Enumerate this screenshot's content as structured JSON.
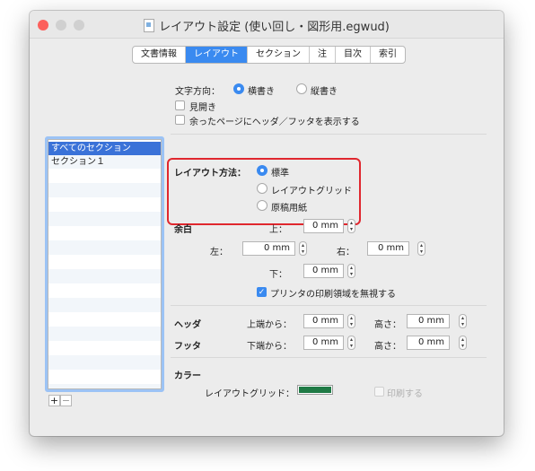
{
  "window": {
    "title": "レイアウト設定 (使い回し・図形用.egwud)",
    "traffic_lights": {
      "close": "#fc605c",
      "minimize": "#d0d0d0",
      "zoom": "#d0d0d0"
    }
  },
  "tabs": [
    {
      "label": "文書情報",
      "active": false
    },
    {
      "label": "レイアウト",
      "active": true
    },
    {
      "label": "セクション",
      "active": false
    },
    {
      "label": "注",
      "active": false
    },
    {
      "label": "目次",
      "active": false
    },
    {
      "label": "索引",
      "active": false
    }
  ],
  "text_direction": {
    "label": "文字方向：",
    "options": [
      {
        "label": "横書き",
        "selected": true
      },
      {
        "label": "縦書き",
        "selected": false
      }
    ]
  },
  "options": {
    "spread": {
      "label": "見開き",
      "checked": false
    },
    "header_footer_extra": {
      "label": "余ったページにヘッダ／フッタを表示する",
      "checked": false
    }
  },
  "sections": {
    "items": [
      "すべてのセクション",
      "セクション１"
    ],
    "selected_index": 0,
    "add_label": "+",
    "remove_label": "−"
  },
  "layout_method": {
    "label": "レイアウト方法：",
    "options": [
      {
        "label": "標準",
        "selected": true
      },
      {
        "label": "レイアウトグリッド",
        "selected": false
      },
      {
        "label": "原稿用紙",
        "selected": false
      }
    ]
  },
  "margins": {
    "label": "余白",
    "top_label": "上：",
    "top_value": "0 mm",
    "left_label": "左：",
    "left_value": "0 mm",
    "right_label": "右：",
    "right_value": "0 mm",
    "bottom_label": "下：",
    "bottom_value": "0 mm",
    "ignore_print_area": {
      "label": "プリンタの印刷領域を無視する",
      "checked": true
    }
  },
  "header": {
    "label": "ヘッダ",
    "from_top_label": "上端から：",
    "from_top_value": "0 mm",
    "height_label": "高さ：",
    "height_value": "0 mm"
  },
  "footer": {
    "label": "フッタ",
    "from_bottom_label": "下端から：",
    "from_bottom_value": "0 mm",
    "height_label": "高さ：",
    "height_value": "0 mm"
  },
  "color": {
    "label": "カラー",
    "layout_grid_label": "レイアウトグリッド：",
    "layout_grid_color": "#1f7a45",
    "print": {
      "label": "印刷する",
      "checked": false,
      "enabled": false
    }
  },
  "accent_color": "#3a8af0",
  "highlight_color": "#e0272e"
}
